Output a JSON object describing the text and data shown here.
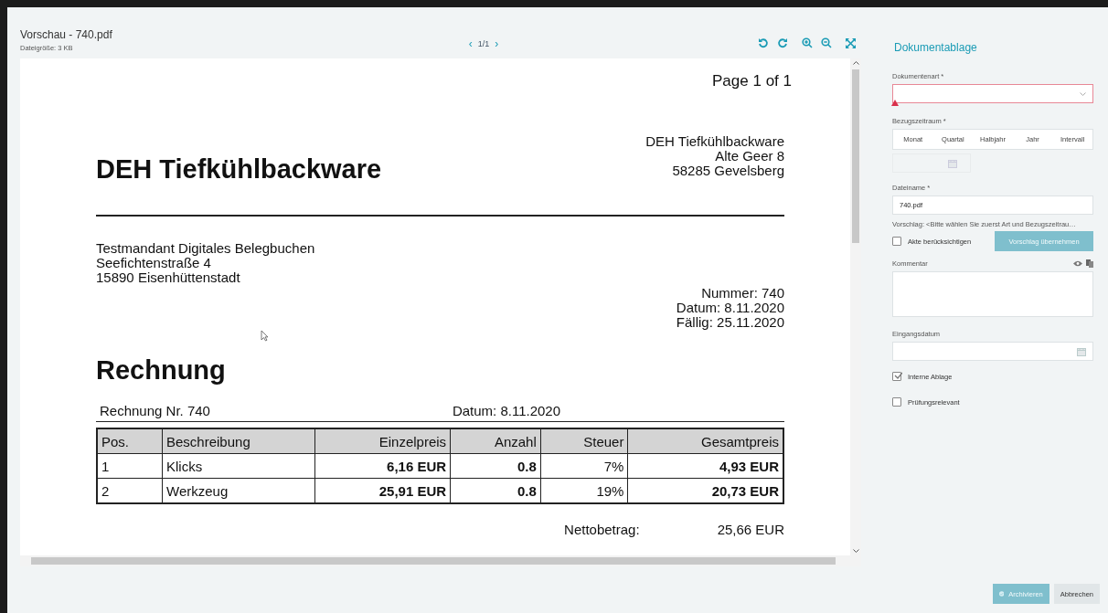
{
  "viewer": {
    "title": "Vorschau - 740.pdf",
    "filesize": "Dateigröße: 3 KB",
    "pager": {
      "prev": "‹",
      "pages": "1/1",
      "next": "›"
    }
  },
  "document": {
    "page_label": "Page 1 of 1",
    "company": "DEH Tiefkühlbackware",
    "sender": [
      "DEH Tiefkühlbackware",
      "Alte Geer 8",
      "58285 Gevelsberg"
    ],
    "recipient": [
      "Testmandant Digitales Belegbuchen",
      "Seefichtenstraße  4",
      "15890 Eisenhüttenstadt"
    ],
    "meta": [
      "Nummer: 740",
      "Datum: 8.11.2020",
      "Fällig: 25.11.2020"
    ],
    "heading": "Rechnung",
    "invoice_no": "Rechnung Nr. 740",
    "invoice_date": "Datum: 8.11.2020",
    "table": {
      "columns": [
        "Pos.",
        "Beschreibung",
        "Einzelpreis",
        "Anzahl",
        "Steuer",
        "Gesamtpreis"
      ],
      "rows": [
        [
          "1",
          "Klicks",
          "6,16 EUR",
          "0.8",
          "7%",
          "4,93 EUR"
        ],
        [
          "2",
          "Werkzeug",
          "25,91 EUR",
          "0.8",
          "19%",
          "20,73 EUR"
        ]
      ]
    },
    "net_label": "Nettobetrag:",
    "net_value": "25,66 EUR"
  },
  "panel": {
    "title": "Dokumentablage",
    "doc_type": {
      "label": "Dokumentenart *",
      "invalid": true
    },
    "period": {
      "label": "Bezugszeitraum *",
      "options": [
        {
          "label": "Monat",
          "selected": false
        },
        {
          "label": "Quartal",
          "selected": false
        },
        {
          "label": "Halbjahr",
          "selected": false
        },
        {
          "label": "Jahr",
          "selected": false
        },
        {
          "label": "Intervall",
          "selected": false
        }
      ]
    },
    "filename": {
      "label": "Dateiname *",
      "value": "740.pdf"
    },
    "suggestion": "Vorschlag: <Bitte wählen Sie zuerst Art und Bezugszeitrau…",
    "akte": {
      "label": "Akte berücksichtigen",
      "checked": false
    },
    "apply_button": {
      "label": "Vorschlag übernehmen",
      "disabled": true
    },
    "comment": {
      "label": "Kommentar"
    },
    "received": {
      "label": "Eingangsdatum"
    },
    "checks": [
      {
        "label": "Interne Ablage",
        "checked": true
      },
      {
        "label": "Prüfungsrelevant",
        "checked": false
      }
    ]
  },
  "buttons": [
    {
      "label": "Archivieren",
      "kind": "primary",
      "disabled": true
    },
    {
      "label": "Abbrechen",
      "kind": "secondary",
      "disabled": false
    }
  ]
}
